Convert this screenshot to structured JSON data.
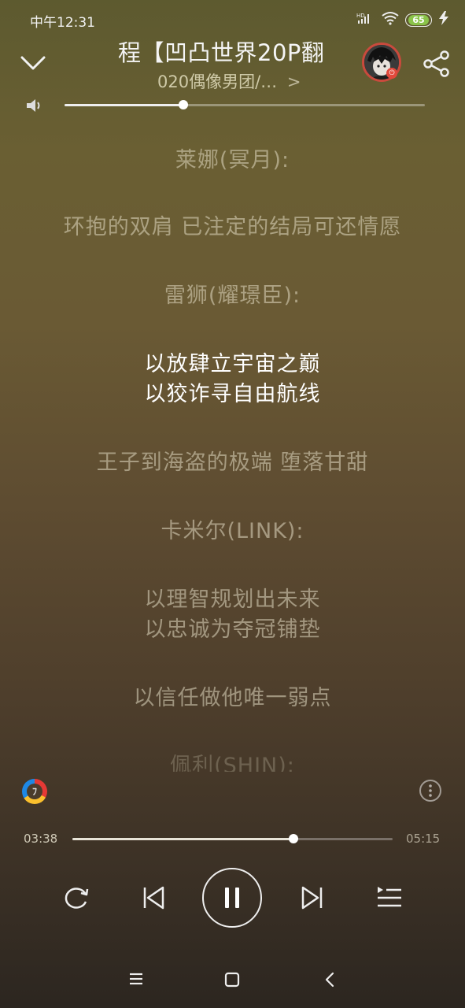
{
  "status_bar": {
    "time": "中午12:31",
    "signal_label": "HD",
    "battery": "65"
  },
  "header": {
    "song_title": "程【凹凸世界20P翻",
    "artist_line": "020偶像男团/…",
    "artist_chevron": ">"
  },
  "volume": {
    "level": 0.33
  },
  "lyrics": [
    {
      "text": "莱娜(冥月):",
      "state": "normal"
    },
    {
      "text": "环抱的双肩 已注定的结局可还情愿",
      "state": "normal"
    },
    {
      "text": "雷狮(耀璟臣):",
      "state": "normal"
    },
    {
      "text": "以放肆立宇宙之巅",
      "state": "active"
    },
    {
      "text": "以狡诈寻自由航线",
      "state": "active"
    },
    {
      "text": "王子到海盗的极端 堕落甘甜",
      "state": "normal"
    },
    {
      "text": "卡米尔(LINK):",
      "state": "normal"
    },
    {
      "text": "以理智规划出未来",
      "state": "normal"
    },
    {
      "text": "以忠诚为夺冠铺垫",
      "state": "normal"
    },
    {
      "text": "以信任做他唯一弱点",
      "state": "normal"
    },
    {
      "text": "佩利(SHIN):",
      "state": "faded"
    }
  ],
  "player": {
    "current_time": "03:38",
    "total_time": "05:15",
    "progress": 0.69,
    "logo_glyph": "ﾌ"
  },
  "colors": {
    "accent_red": "#c94a3d",
    "battery_green": "#8bc34a"
  },
  "icons": {
    "collapse": "chevron-down-icon",
    "share": "share-icon",
    "volume": "speaker-icon",
    "repeat": "repeat-icon",
    "prev": "previous-icon",
    "play": "pause-icon",
    "next": "next-icon",
    "queue": "playlist-icon",
    "more": "more-vertical-icon"
  }
}
